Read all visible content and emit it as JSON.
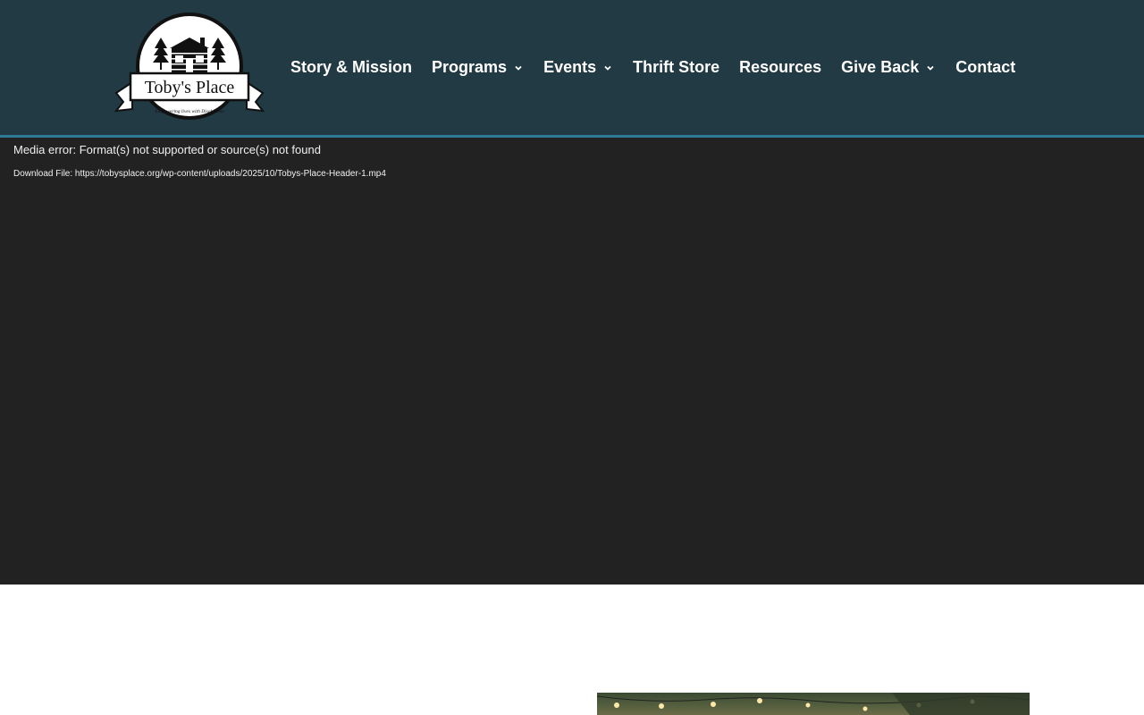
{
  "header": {
    "logo": {
      "name": "Toby's Place",
      "tagline": "Empowering lives with Disabilities"
    },
    "nav": [
      {
        "label": "Story & Mission",
        "has_dropdown": false
      },
      {
        "label": "Programs",
        "has_dropdown": true
      },
      {
        "label": "Events",
        "has_dropdown": true
      },
      {
        "label": "Thrift Store",
        "has_dropdown": false
      },
      {
        "label": "Resources",
        "has_dropdown": false
      },
      {
        "label": "Give Back",
        "has_dropdown": true
      },
      {
        "label": "Contact",
        "has_dropdown": false
      }
    ]
  },
  "media": {
    "error_text": "Media error: Format(s) not supported or source(s) not found",
    "download_prefix": "Download File: ",
    "download_url": "https://tobysplace.org/wp-content/uploads/2025/10/Tobys-Place-Header-1.mp4"
  },
  "colors": {
    "header_bg": "#213a44",
    "header_border": "#2e7a98",
    "media_bg": "#222222",
    "nav_text": "#ffffff"
  }
}
